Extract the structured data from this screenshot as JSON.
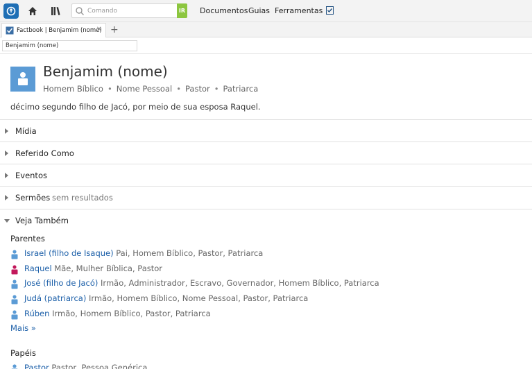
{
  "toolbar": {
    "search_placeholder": "Comando",
    "go_label": "IR",
    "menu": [
      "Documentos",
      "Guias",
      "Ferramentas"
    ]
  },
  "tab": {
    "title": "Factbook | Benjamim (nome)"
  },
  "reference": {
    "value": "Benjamim (nome)"
  },
  "entry": {
    "title": "Benjamim (nome)",
    "tags": [
      "Homem Bíblico",
      "Nome Pessoal",
      "Pastor",
      "Patriarca"
    ],
    "description": "décimo segundo filho de Jacó, por meio de sua esposa Raquel."
  },
  "sections": {
    "media": "Mídia",
    "referred": "Referido Como",
    "events": "Eventos",
    "sermons": "Sermões",
    "sermons_note": "sem resultados",
    "see_also": "Veja Também"
  },
  "see_also": {
    "relatives_title": "Parentes",
    "relatives": [
      {
        "name": "Israel (filho de Isaque)",
        "info": "Pai, Homem Bíblico, Pastor, Patriarca",
        "gender": "male"
      },
      {
        "name": "Raquel",
        "info": "Mãe, Mulher Bíblica, Pastor",
        "gender": "female"
      },
      {
        "name": "José (filho de Jacó)",
        "info": "Irmão, Administrador, Escravo, Governador, Homem Bíblico, Patriarca",
        "gender": "male"
      },
      {
        "name": "Judá (patriarca)",
        "info": "Irmão, Homem Bíblico, Nome Pessoal, Pastor, Patriarca",
        "gender": "male"
      },
      {
        "name": "Rúben",
        "info": "Irmão, Homem Bíblico, Pastor, Patriarca",
        "gender": "male"
      }
    ],
    "more_label": "Mais »",
    "roles_title": "Papéis",
    "roles": [
      {
        "name": "Pastor",
        "info": "Pastor, Pessoa Genérica",
        "gender": "male"
      }
    ]
  },
  "colors": {
    "male_icon": "#5b9bd5",
    "female_icon": "#c2185b",
    "link": "#1a5ea8",
    "go_button": "#8cc63f"
  }
}
